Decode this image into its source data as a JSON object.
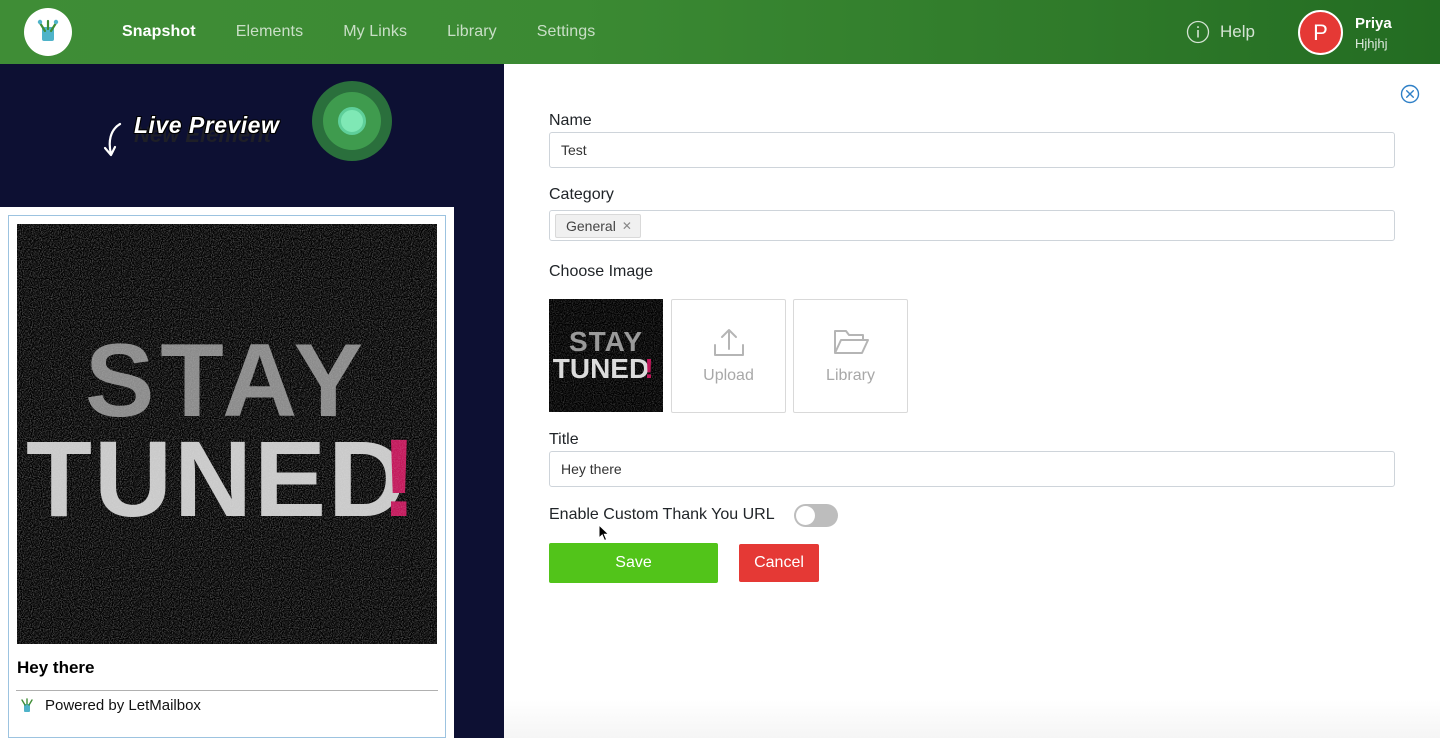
{
  "nav": {
    "items": [
      "Snapshot",
      "Elements",
      "My Links",
      "Library",
      "Settings"
    ],
    "active": "Snapshot",
    "help_label": "Help",
    "user": {
      "initial": "P",
      "name": "Priya",
      "subtitle": "Hjhjhj"
    },
    "colors": {
      "start": "#3f8d36",
      "end": "#236c22",
      "avatar": "#e53935"
    }
  },
  "preview": {
    "live_label": "Live Preview",
    "ghost_label": "New Element",
    "image_text": [
      "STAY",
      "TUNED",
      "!"
    ],
    "title": "Hey there",
    "powered_by": "Powered by LetMailbox"
  },
  "form": {
    "name_label": "Name",
    "name_value": "Test",
    "category_label": "Category",
    "category_tags": [
      "General"
    ],
    "image_label": "Choose Image",
    "thumb_text": [
      "STAY",
      "TUNED",
      "!"
    ],
    "upload_label": "Upload",
    "library_label": "Library",
    "title_label": "Title",
    "title_value": "Hey there",
    "toggle_label": "Enable Custom Thank You URL",
    "toggle_on": false,
    "save_label": "Save",
    "cancel_label": "Cancel",
    "colors": {
      "save": "#52c41a",
      "cancel": "#e53935"
    }
  }
}
